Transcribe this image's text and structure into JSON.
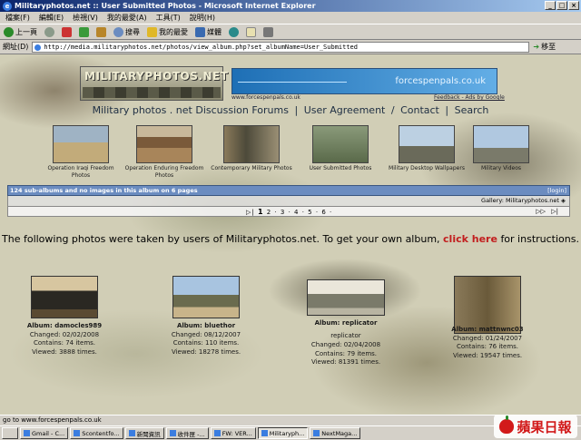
{
  "window": {
    "title": "Militaryphotos.net :: User Submitted Photos - Microsoft Internet Explorer",
    "buttons": [
      "_",
      "□",
      "×"
    ]
  },
  "menu": [
    "檔案(F)",
    "編輯(E)",
    "檢視(V)",
    "我的最愛(A)",
    "工具(T)",
    "說明(H)"
  ],
  "toolbar": {
    "back": "上一頁",
    "search": "搜尋",
    "favorites": "我的最愛",
    "media": "媒體"
  },
  "address": {
    "label": "網址(D)",
    "url": "http://media.militaryphotos.net/photos/view_album.php?set_albumName=User_Submitted",
    "go": "移至"
  },
  "banner": {
    "logo_text": "MILITARYPHOTOS.NET",
    "ad_text": "forcespenpals.co.uk",
    "ad_url": "www.forcespenpals.co.uk",
    "ad_feedback": "Feedback - Ads by Google"
  },
  "topnav": {
    "home": "Military photos . net",
    "forums": "Discussion Forums",
    "agreement": "User Agreement",
    "contact": "Contact",
    "search": "Search"
  },
  "gallery": [
    {
      "caption": "Operation Iraqi Freedom Photos"
    },
    {
      "caption": "Operation Enduring Freedom Photos"
    },
    {
      "caption": "Contemporary Military Photos"
    },
    {
      "caption": "User Submitted Photos"
    },
    {
      "caption": "Military Desktop Wallpapers"
    },
    {
      "caption": "Military Videos"
    }
  ],
  "infobar": {
    "text": "124 sub-albums and no images in this album on 6 pages",
    "login": "[login]"
  },
  "gallery_row": "Gallery: Militaryphotos.net",
  "pager": {
    "current": "1",
    "others": "2 · 3 · 4 · 5 · 6 ·",
    "prev_glyph": "▷|",
    "next_glyph": "▷▷",
    "last_glyph": "▷|"
  },
  "headline": {
    "before": "The following photos were taken by users of Militaryphotos.net. To get your own album,",
    "link": "click here",
    "after": "for instructions."
  },
  "albums": [
    {
      "name": "Album: damocles989",
      "subtitle": "",
      "changed": "Changed: 02/02/2008",
      "contains": "Contains: 74 items.",
      "viewed": "Viewed: 3888 times."
    },
    {
      "name": "Album: bluethor",
      "subtitle": "",
      "changed": "Changed: 08/12/2007",
      "contains": "Contains: 110 items.",
      "viewed": "Viewed: 18278 times."
    },
    {
      "name": "Album: replicator",
      "subtitle": "replicator",
      "changed": "Changed: 02/04/2008",
      "contains": "Contains: 79 items.",
      "viewed": "Viewed: 81391 times."
    },
    {
      "name": "Album: mattnwnc03",
      "subtitle": "",
      "changed": "Changed: 01/24/2007",
      "contains": "Contains: 76 items.",
      "viewed": "Viewed: 19547 times."
    }
  ],
  "status": "go to www.forcespenpals.co.uk",
  "taskbar": [
    "Gmail - C...",
    "Scontentfo...",
    "新聞資訊",
    "收件匣 -...",
    "FW: VER...",
    "Militaryph...",
    "NextMaga..."
  ],
  "watermark": "蘋果日報"
}
